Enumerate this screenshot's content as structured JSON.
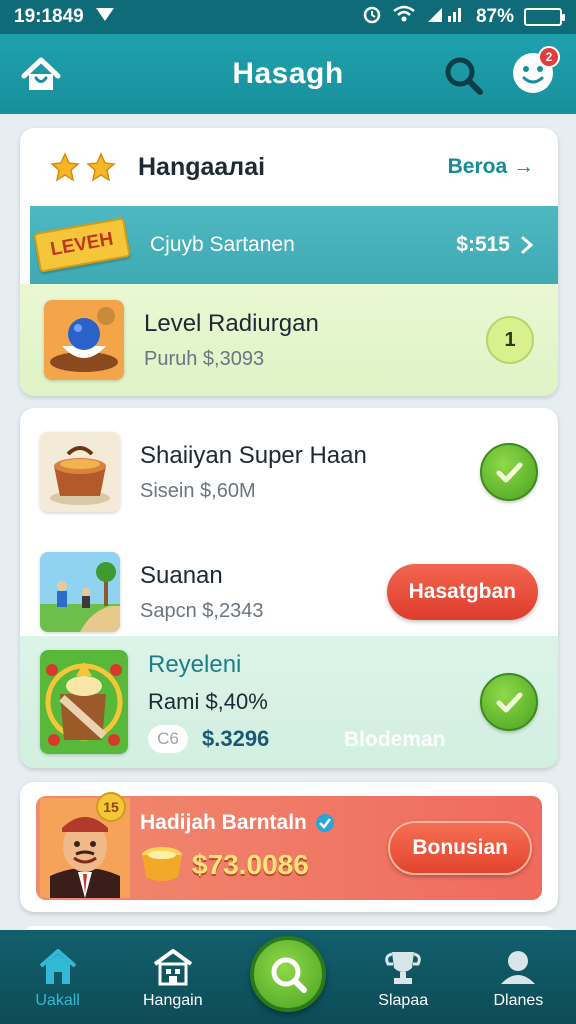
{
  "status_bar": {
    "time": "19:1849",
    "battery": "87%"
  },
  "app_bar": {
    "title": "Hasagh",
    "notification_count": "2"
  },
  "featured": {
    "header": {
      "name": "Hangaалаі",
      "link": "Beroa →"
    },
    "band": {
      "badge": "LEVEH",
      "label": "Cjuyb Sartanen",
      "amount": "$:515"
    },
    "row": {
      "title": "Level Radiurgan",
      "subtitle": "Puruh $,3093",
      "step": "1"
    }
  },
  "list": [
    {
      "title": "Shaiiyan Super Haan",
      "subtitle": "Sisein $,60M"
    },
    {
      "title": "Suanan",
      "subtitle": "Sapcn $,2343",
      "action": "Hasatgban"
    },
    {
      "title": "Reyeleni",
      "subtitle": "Rami $,40%",
      "pill": "C6",
      "amount": "$.3296",
      "ghost": "Blodeman"
    }
  ],
  "promo": {
    "title": "Hadijah Barntaln",
    "amount": "$73.0086",
    "badge": "15",
    "button": "Bonusian"
  },
  "bottom_nav": [
    {
      "label": "Uakall",
      "icon": "home-icon"
    },
    {
      "label": "Hangain",
      "icon": "store-icon"
    },
    {
      "label": "",
      "icon": "search-icon"
    },
    {
      "label": "Slapaa",
      "icon": "trophy-icon"
    },
    {
      "label": "Dlanes",
      "icon": "profile-icon"
    }
  ]
}
